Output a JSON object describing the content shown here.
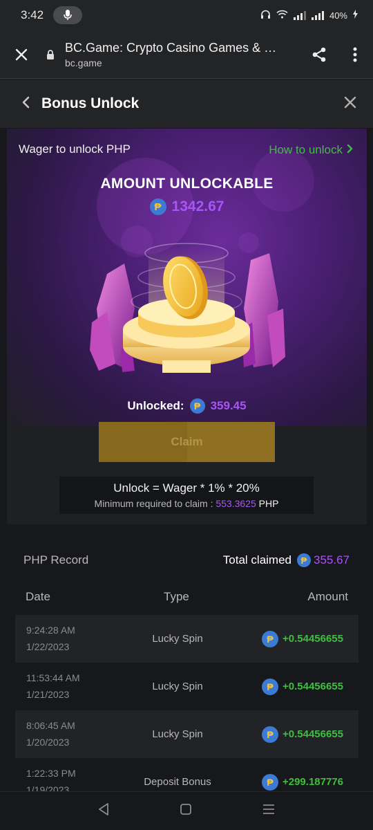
{
  "status_bar": {
    "time": "3:42",
    "battery": "40%"
  },
  "browser": {
    "title": "BC.Game: Crypto Casino Games & Ca...",
    "url": "bc.game"
  },
  "header": {
    "title": "Bonus Unlock"
  },
  "promo": {
    "wager_label": "Wager to unlock PHP",
    "how_to_label": "How to unlock",
    "amount_title": "AMOUNT UNLOCKABLE",
    "amount_value": "1342.67",
    "unlocked_label": "Unlocked:",
    "unlocked_value": "359.45",
    "claim_label": "Claim",
    "formula": "Unlock = Wager * 1% * 20%",
    "min_label": "Minimum required to claim :",
    "min_value": "553.3625",
    "min_currency": "PHP"
  },
  "record": {
    "title": "PHP Record",
    "total_label": "Total claimed",
    "total_value": "355.67",
    "columns": {
      "date": "Date",
      "type": "Type",
      "amount": "Amount"
    },
    "rows": [
      {
        "time": "9:24:28 AM",
        "date": "1/22/2023",
        "type": "Lucky Spin",
        "amount": "+0.54456655"
      },
      {
        "time": "11:53:44 AM",
        "date": "1/21/2023",
        "type": "Lucky Spin",
        "amount": "+0.54456655"
      },
      {
        "time": "8:06:45 AM",
        "date": "1/20/2023",
        "type": "Lucky Spin",
        "amount": "+0.54456655"
      },
      {
        "time": "1:22:33 PM",
        "date": "1/19/2023",
        "type": "Deposit Bonus",
        "amount": "+299.187776"
      }
    ]
  },
  "currency_symbol": "₱",
  "colors": {
    "accent_purple": "#a855f7",
    "positive_green": "#3fbf3f",
    "claim_gold": "#87691e"
  }
}
